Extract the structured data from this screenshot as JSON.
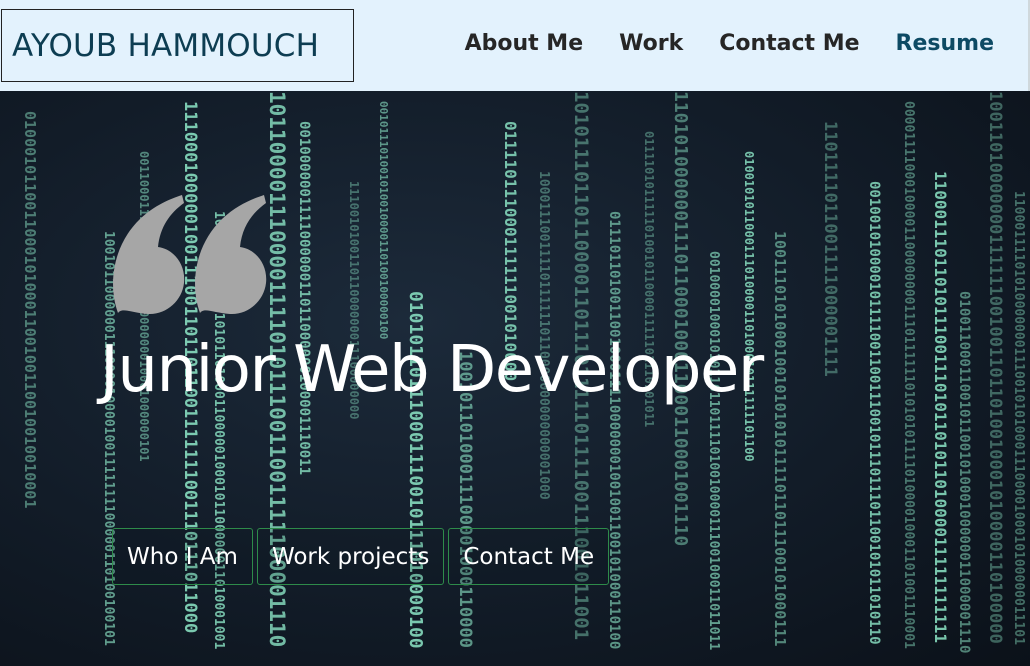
{
  "header": {
    "logo_text": "AYOUB HAMMOUCH",
    "nav": [
      {
        "label": "About Me"
      },
      {
        "label": "Work"
      },
      {
        "label": "Contact Me"
      },
      {
        "label": "Resume"
      }
    ]
  },
  "hero": {
    "quote_icon": "quote-open-icon",
    "headline": "Junior Web Developer",
    "buttons": [
      {
        "label": "Who I Am"
      },
      {
        "label": "Work projects"
      },
      {
        "label": "Contact Me"
      }
    ],
    "background": "binary-matrix-rain"
  },
  "colors": {
    "nav_background": "#e3f2fd",
    "logo_text": "#0d3d52",
    "resume_link": "#0d4a64",
    "hero_background": "#121c28",
    "binary_digits": "#8ee8c8",
    "button_border": "#2e8b4a",
    "quote_mark": "#a6a6a6"
  }
}
